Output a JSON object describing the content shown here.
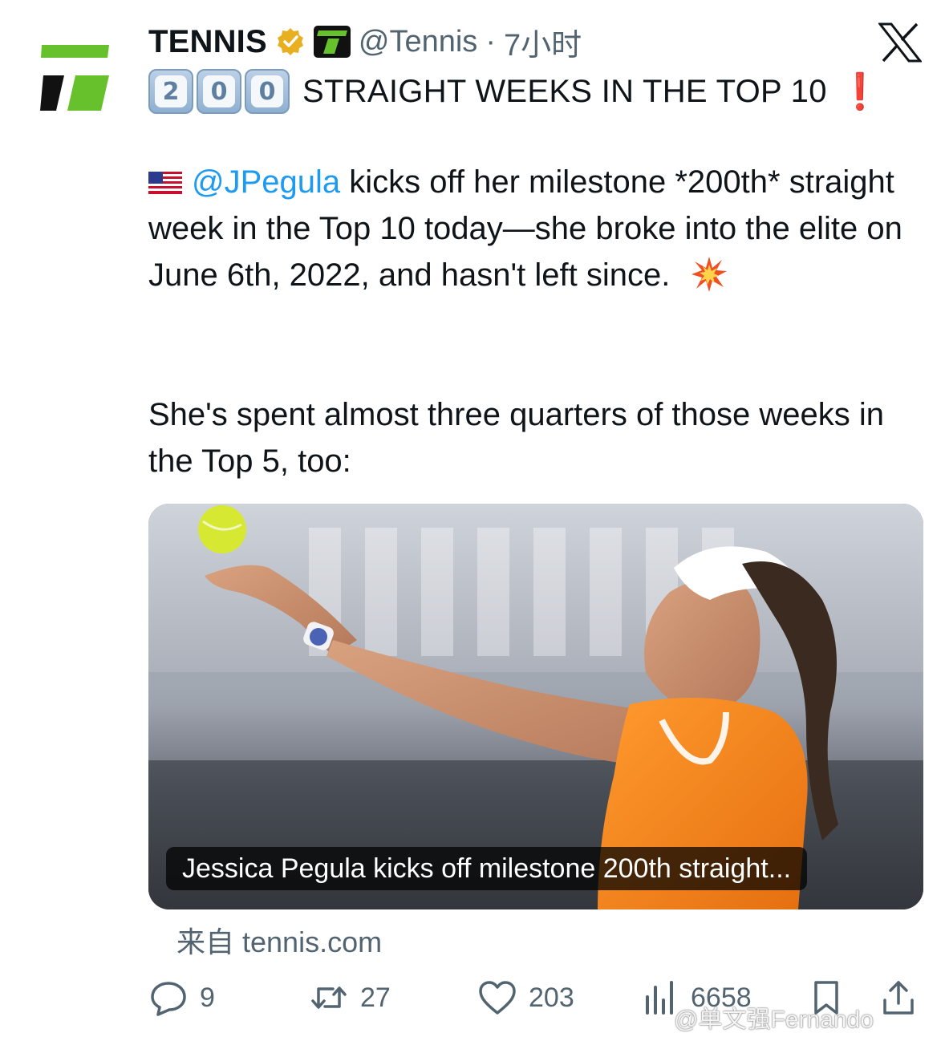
{
  "account": {
    "display_name": "TENNIS",
    "handle": "@Tennis",
    "separator": "·",
    "time": "7小时"
  },
  "headline": {
    "digits": [
      "2",
      "0",
      "0"
    ],
    "text": "STRAIGHT WEEKS IN THE TOP 10",
    "emoji": "❗"
  },
  "body": {
    "mention": "@JPegula",
    "para1_rest": " kicks off her milestone *200th* straight week in the Top 10 today—she broke into the elite on June 6th, 2022, and hasn't left since.",
    "para2": "She's spent almost three quarters of those weeks in the Top 5, too:"
  },
  "card": {
    "caption": "Jessica Pegula kicks off milestone 200th straight...",
    "source": "来自 tennis.com"
  },
  "actions": {
    "replies": "9",
    "reposts": "27",
    "likes": "203",
    "views": "6658"
  },
  "watermark": "@单文强Fernando",
  "icons": {
    "avatar": "tennis-channel-logo",
    "verified": "gold-verified-badge-icon",
    "brand": "tennis-t-badge-icon",
    "platform": "x-logo-icon",
    "flag": "us-flag-icon",
    "burst": "collision-emoji-icon",
    "reply": "reply-icon",
    "repost": "repost-icon",
    "like": "heart-icon",
    "views": "views-icon",
    "bookmark": "bookmark-icon",
    "share": "share-icon"
  },
  "colors": {
    "link": "#1d9bf0",
    "secondary": "#536471",
    "brand_green": "#5fbf2a",
    "alert": "#e0242b"
  }
}
